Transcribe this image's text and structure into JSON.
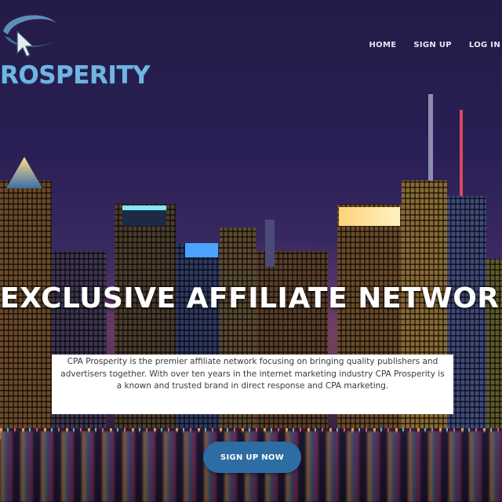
{
  "brand": {
    "logo_text": "ROSPERITY",
    "logo_icon": "cursor-arrow-swoosh-icon",
    "accent_color": "#6fb6e2"
  },
  "nav": {
    "items": [
      {
        "label": "HOME"
      },
      {
        "label": "SIGN UP"
      },
      {
        "label": "LOG IN"
      }
    ]
  },
  "hero": {
    "headline": "EXCLUSIVE AFFILIATE NETWORK",
    "description": "CPA Prosperity is the premier affiliate network focusing on bringing quality publishers and advertisers together. With over ten years in the internet marketing industry CPA Prosperity is a known and trusted brand in direct response and CPA marketing.",
    "cta_label": "SIGN UP NOW",
    "cta_color": "#2d6da3"
  }
}
